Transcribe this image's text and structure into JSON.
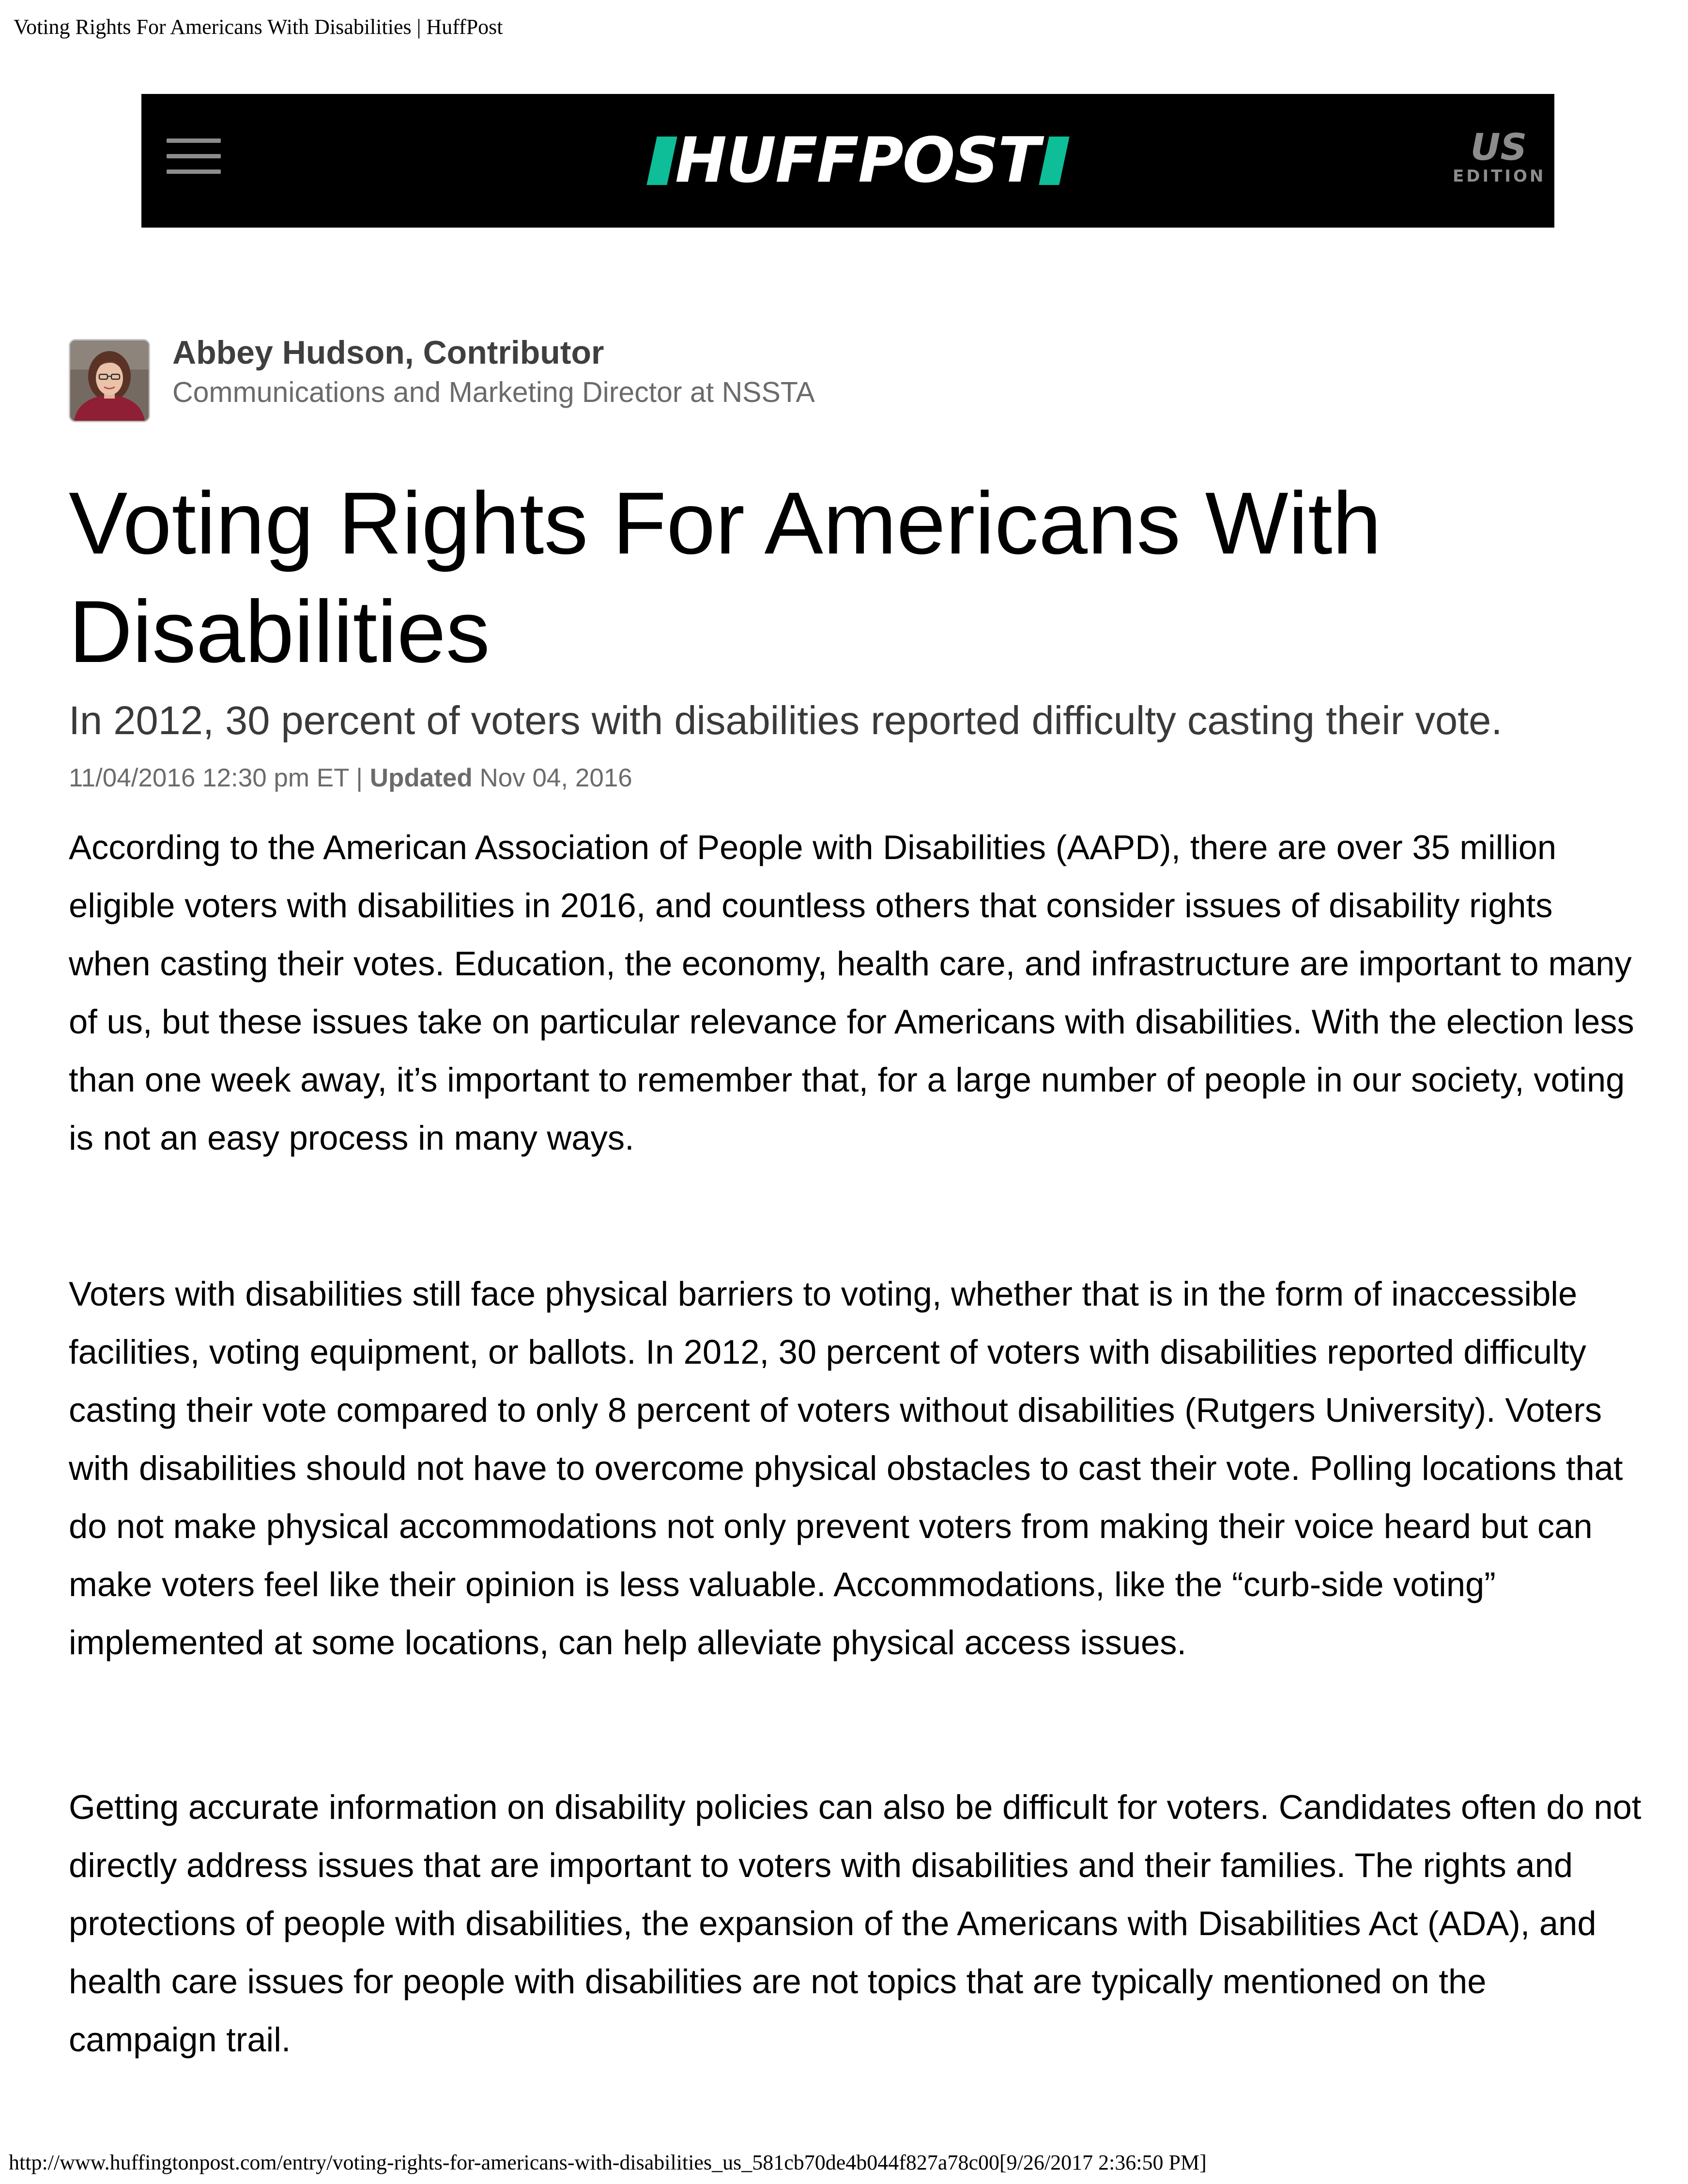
{
  "print": {
    "header": "Voting Rights For Americans With Disabilities | HuffPost",
    "footer": "http://www.huffingtonpost.com/entry/voting-rights-for-americans-with-disabilities_us_581cb70de4b044f827a78c00[9/26/2017 2:36:50 PM]"
  },
  "masthead": {
    "menu_icon": "hamburger-menu-icon",
    "logo": "HUFFPOST",
    "edition_code": "US",
    "edition_label": "EDITION",
    "colors": {
      "background": "#000000",
      "accent": "#0dbe98",
      "muted": "#8c8c8c"
    }
  },
  "author": {
    "name": "Abbey Hudson, Contributor",
    "role": "Communications and Marketing Director at NSSTA"
  },
  "article": {
    "headline": "Voting Rights For Americans With Disabilities",
    "dek": "In 2012, 30 percent of voters with disabilities reported difficulty casting their vote.",
    "published": "11/04/2016 12:30 pm ET |",
    "updated_label": "Updated",
    "updated": "Nov 04, 2016",
    "paragraphs": [
      "According to the American Association of People with Disabilities (AAPD), there are over 35 million eligible voters with disabilities in 2016, and countless others that consider issues of disability rights when casting their votes. Education, the economy, health care, and infrastructure are important to many of us, but these issues take on particular relevance for Americans with disabilities. With the election less than one week away, it’s important to remember that, for a large number of people in our society, voting is not an easy process in many ways.",
      "Voters with disabilities still face physical barriers to voting, whether that is in the form of inaccessible facilities, voting equipment, or ballots. In 2012, 30 percent of voters with disabilities reported difficulty casting their vote compared to only 8 percent of voters without disabilities (Rutgers University). Voters with disabilities should not have to overcome physical obstacles to cast their vote. Polling locations that do not make physical accommodations not only prevent voters from making their voice heard but can make voters feel like their opinion is less valuable. Accommodations, like the “curb-side voting” implemented at some locations, can help alleviate physical access issues.",
      "Getting accurate information on disability policies can also be difficult for voters. Candidates often do not directly address issues that are important to voters with disabilities and their families. The rights and protections of people with disabilities, the expansion of the Americans with Disabilities Act (ADA), and health care issues for people with disabilities are not topics that are typically mentioned on the campaign trail."
    ]
  }
}
